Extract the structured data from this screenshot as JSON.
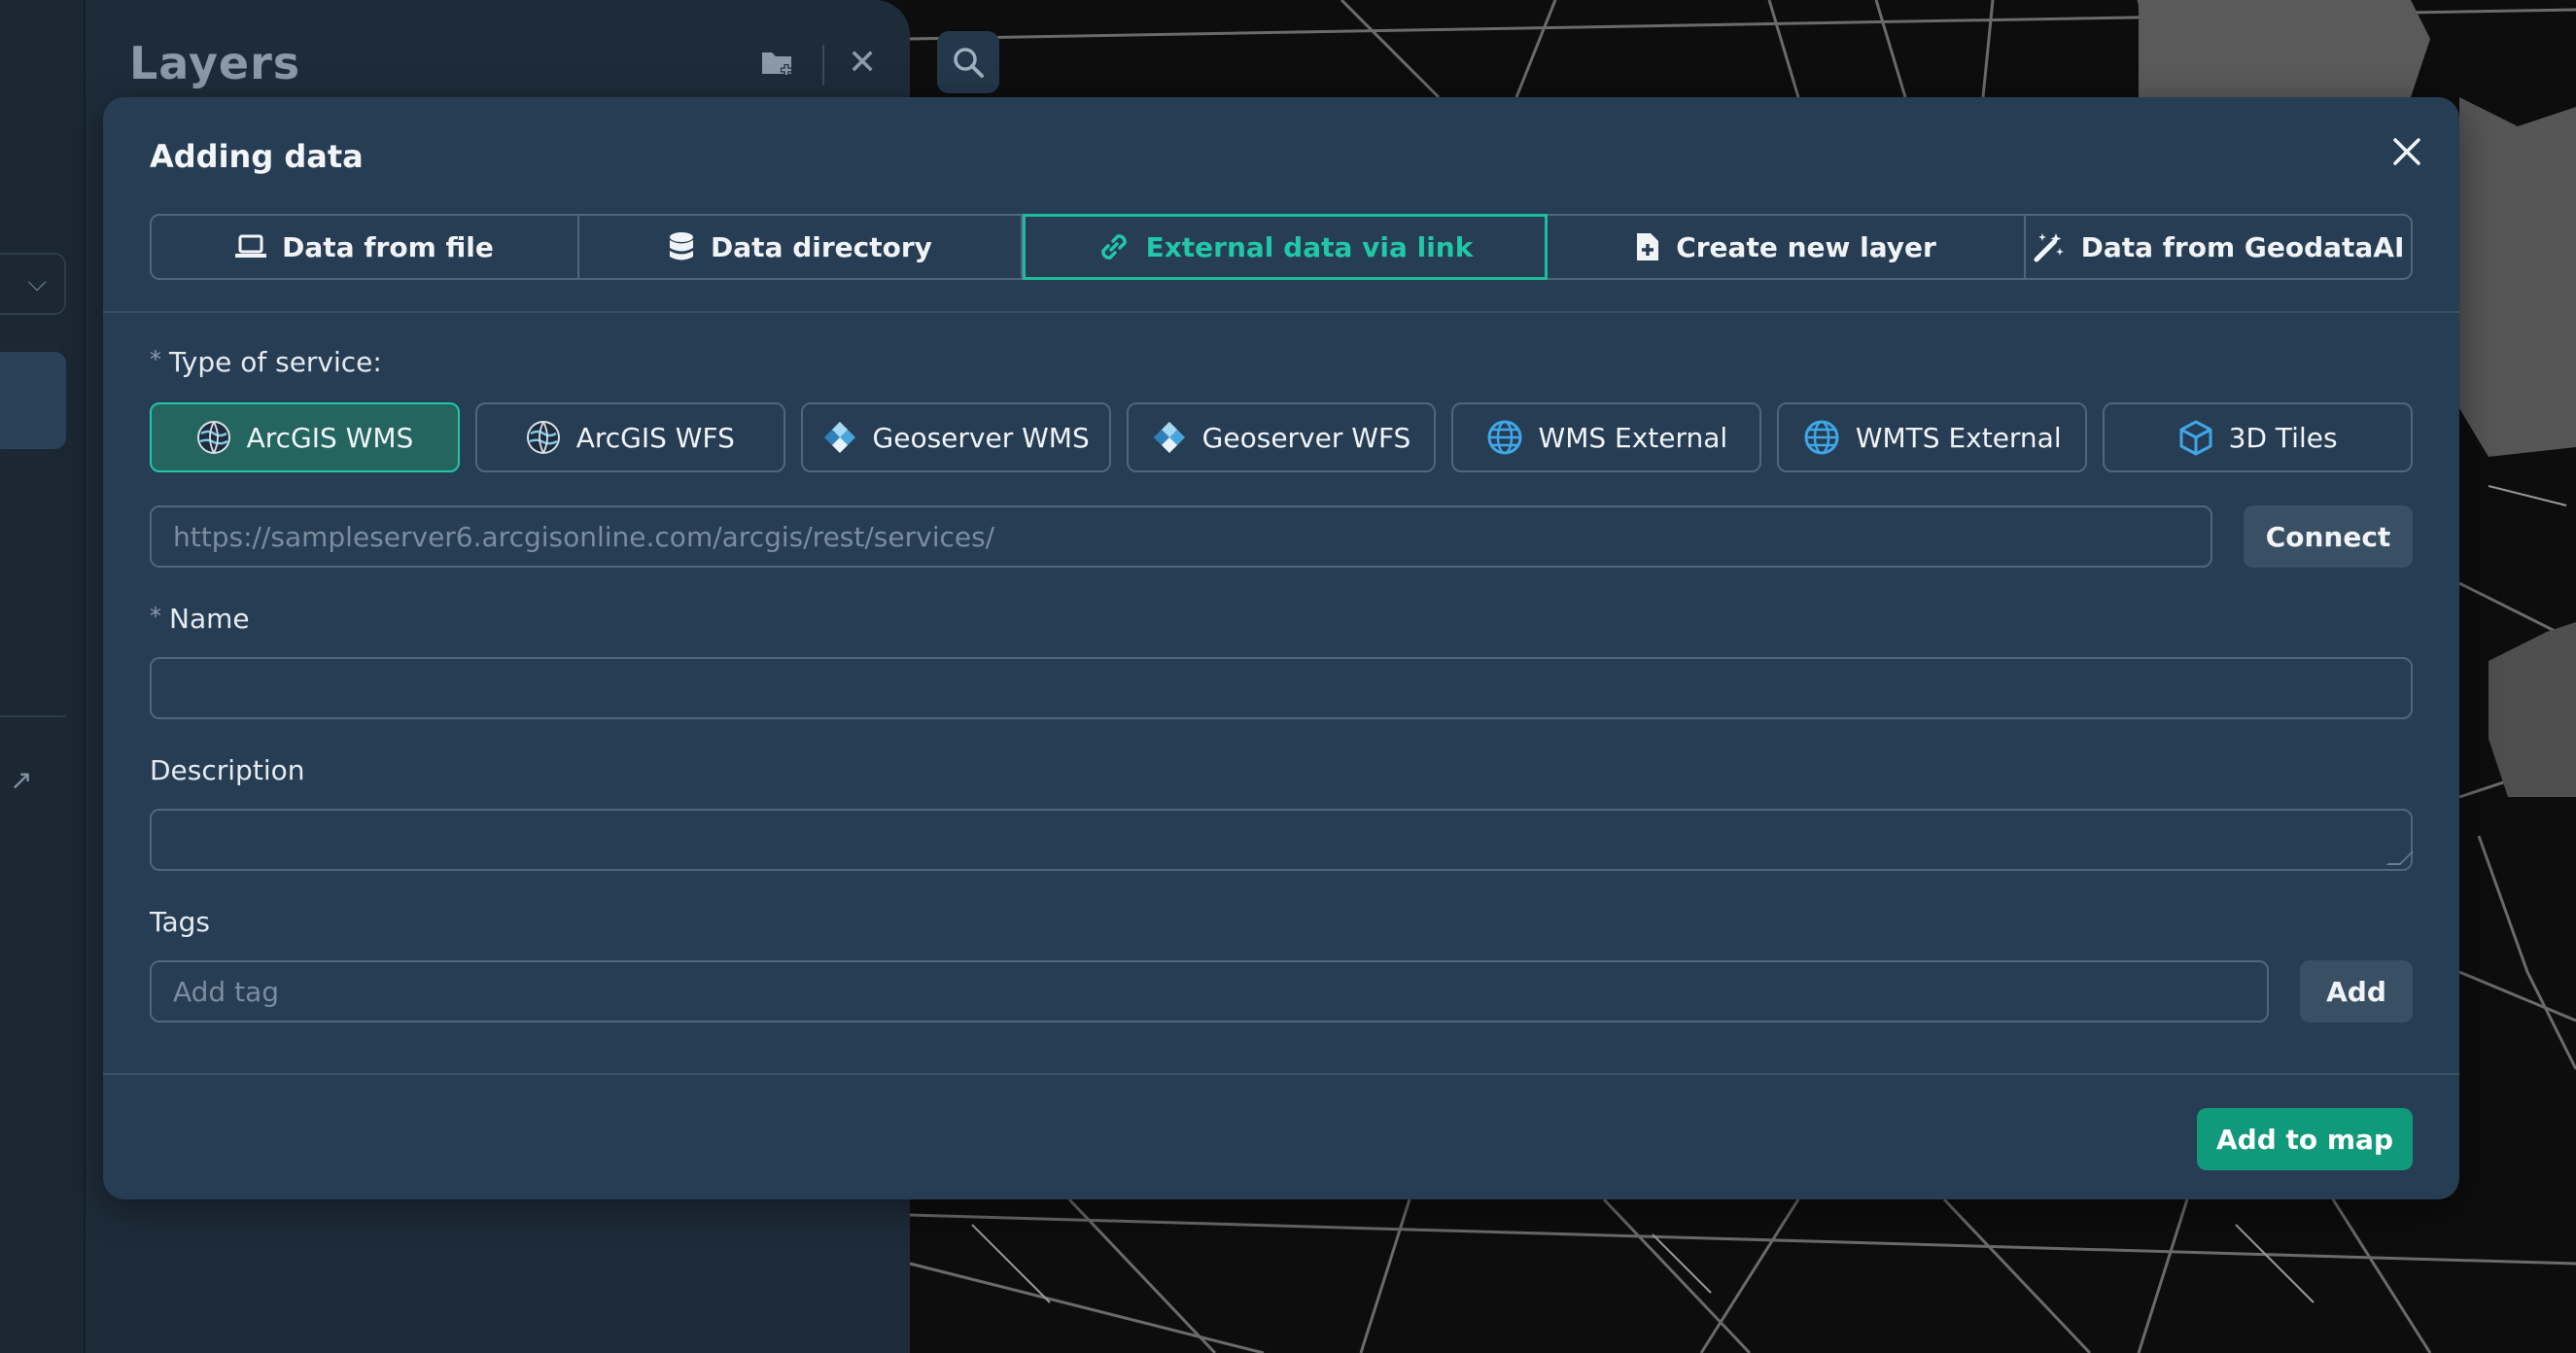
{
  "layers_panel": {
    "title": "Layers",
    "close_glyph": "✕",
    "icons": [
      "folder-add-icon",
      "close-icon"
    ]
  },
  "rail": {
    "dropdown_glyph": "⌵",
    "arrow_glyph": "↗"
  },
  "modal": {
    "title": "Adding data",
    "tabs": [
      {
        "label": "Data from file",
        "icon": "laptop-icon"
      },
      {
        "label": "Data directory",
        "icon": "database-icon"
      },
      {
        "label": "External data via link",
        "icon": "link-icon"
      },
      {
        "label": "Create new layer",
        "icon": "file-plus-icon"
      },
      {
        "label": "Data from GeodataAI",
        "icon": "magic-wand-icon"
      }
    ],
    "active_tab": "External data via link",
    "service_type": {
      "required_mark": "*",
      "label": "Type of service:",
      "options": [
        {
          "label": "ArcGIS WMS",
          "icon": "arcgis-globe-icon"
        },
        {
          "label": "ArcGIS WFS",
          "icon": "arcgis-globe-icon"
        },
        {
          "label": "Geoserver WMS",
          "icon": "geoserver-icon"
        },
        {
          "label": "Geoserver WFS",
          "icon": "geoserver-icon"
        },
        {
          "label": "WMS External",
          "icon": "globe-icon"
        },
        {
          "label": "WMTS External",
          "icon": "globe-icon"
        },
        {
          "label": "3D Tiles",
          "icon": "cube-icon"
        }
      ],
      "selected": "ArcGIS WMS"
    },
    "url": {
      "placeholder": "https://sampleserver6.arcgisonline.com/arcgis/rest/services/",
      "value": "",
      "connect_label": "Connect"
    },
    "name": {
      "required_mark": "*",
      "label": "Name",
      "value": ""
    },
    "description": {
      "label": "Description",
      "value": ""
    },
    "tags": {
      "label": "Tags",
      "placeholder": "Add tag",
      "add_label": "Add"
    },
    "submit_label": "Add to map"
  },
  "colors": {
    "accent": "#21c7a7",
    "primary_button": "#109a7b",
    "modal_bg": "#273d54",
    "panel_bg": "#1e2c3a"
  }
}
